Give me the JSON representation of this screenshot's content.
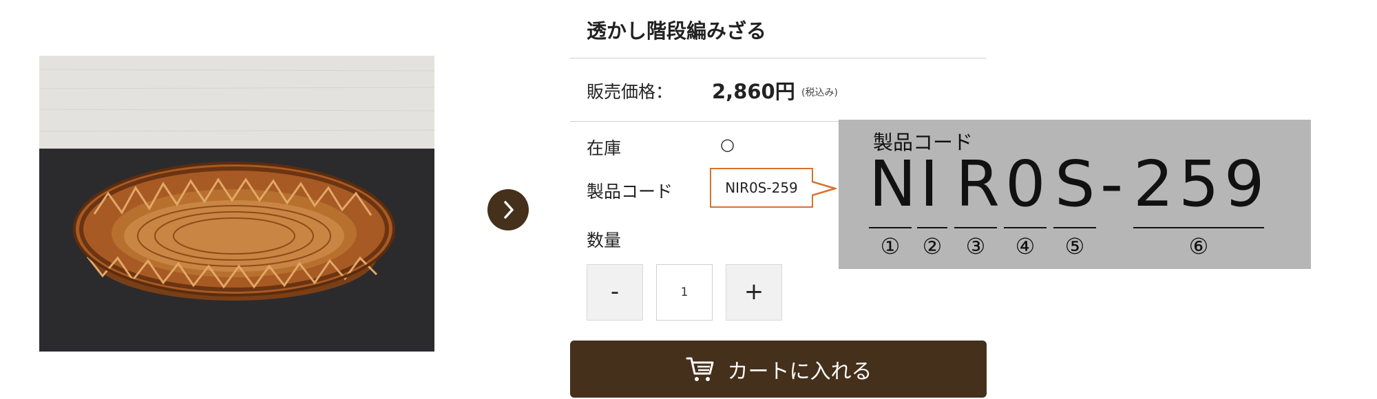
{
  "product": {
    "title": "透かし階段編みざる",
    "price_label": "販売価格：",
    "price_value": "2,860円",
    "tax_note": "(税込み)",
    "stock_label": "在庫",
    "stock_value": "○",
    "code_label": "製品コード",
    "code_value": "NIR0S-259",
    "quantity_label": "数量",
    "quantity_value": "1",
    "minus_label": "-",
    "plus_label": "+",
    "cart_label": "カートに入れる"
  },
  "code_explanation": {
    "title": "製品コード",
    "characters": [
      "N",
      "I",
      "R",
      "0",
      "S",
      "-",
      "2",
      "5",
      "9"
    ],
    "markers": [
      "①",
      "②",
      "③",
      "④",
      "⑤",
      "⑥"
    ]
  },
  "icons": {
    "next": "chevron-right-icon",
    "cart": "cart-icon"
  },
  "colors": {
    "accent_brown": "#45301c",
    "callout_orange": "#d8702d",
    "panel_gray": "#b6b6b6"
  }
}
